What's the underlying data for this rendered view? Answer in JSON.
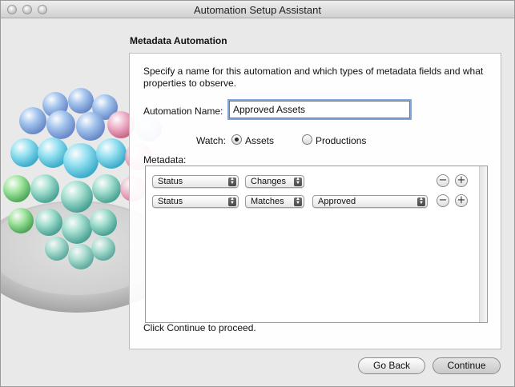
{
  "window": {
    "title": "Automation Setup Assistant"
  },
  "pane": {
    "title": "Metadata Automation",
    "intro": "Specify a name for this automation and which types of metadata fields and what properties to observe.",
    "name_label": "Automation Name:",
    "name_value": "Approved Assets",
    "watch_label": "Watch:",
    "watch_options": [
      {
        "label": "Assets",
        "selected": true
      },
      {
        "label": "Productions",
        "selected": false
      }
    ],
    "metadata_label": "Metadata:",
    "rows": [
      {
        "field": "Status",
        "operator": "Changes",
        "value": null
      },
      {
        "field": "Status",
        "operator": "Matches",
        "value": "Approved"
      }
    ],
    "footer_note": "Click Continue to proceed."
  },
  "buttons": {
    "back": "Go Back",
    "continue": "Continue"
  },
  "icons": {
    "remove": "minus-circle-icon",
    "add": "plus-circle-icon",
    "popup": "up-down-arrows-icon"
  }
}
